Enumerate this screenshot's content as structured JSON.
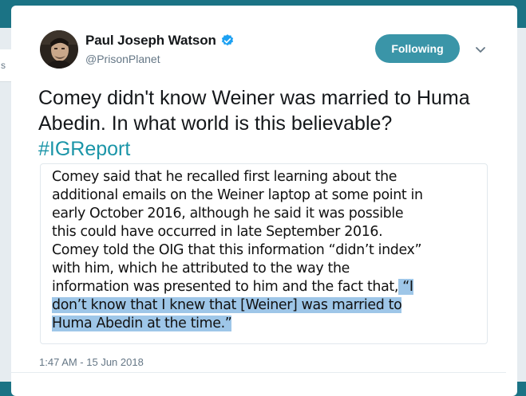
{
  "page": {
    "side_tab_label": "s"
  },
  "tweet": {
    "author": {
      "display_name": "Paul Joseph Watson",
      "handle": "@PrisonPlanet",
      "verified": true
    },
    "follow_button_label": "Following",
    "text": "Comey didn't know Weiner was married to Huma Abedin. In what world is this believable?",
    "hashtag": "#IGReport",
    "timestamp": "1:47 AM - 15 Jun 2018"
  },
  "quote_image": {
    "lines": [
      "Comey said that he recalled first learning about the",
      "additional emails on the Weiner laptop at some point in",
      "early October 2016, although he said it was possible",
      "this could have occurred in late September 2016.",
      "Comey told the OIG that this information “didn’t index”",
      "with him, which he attributed to the way the",
      "information was presented to him and the fact that,"
    ],
    "highlighted_tail": " “I",
    "highlighted_lines": [
      "don’t know that I knew that [Weiner] was married to",
      "Huma Abedin at the time.”"
    ]
  },
  "colors": {
    "header_background": "#1b7385",
    "page_background": "#e6ecf0",
    "follow_button": "#3a95a8",
    "hashtag": "#1b95a8",
    "verified_badge": "#1da1f2",
    "highlight": "#9ec6e8"
  },
  "icons": [
    "verified-badge-icon",
    "chevron-down-icon"
  ]
}
